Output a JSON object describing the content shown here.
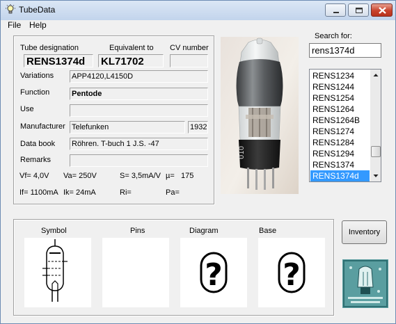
{
  "window": {
    "title": "TubeData"
  },
  "menu": {
    "file": "File",
    "help": "Help"
  },
  "labels": {
    "tube_designation": "Tube designation",
    "equivalent_to": "Equivalent to",
    "cv_number": "CV number",
    "variations": "Variations",
    "function": "Function",
    "use": "Use",
    "manufacturer": "Manufacturer",
    "data_book": "Data book",
    "remarks": "Remarks"
  },
  "tube": {
    "designation": "RENS1374d",
    "equivalent": "KL71702",
    "cv_number": "",
    "variations": "APP4120,L4150D",
    "function": "Pentode",
    "use": "",
    "manufacturer": "Telefunken",
    "year": "1932",
    "data_book": "Röhren. T-buch 1 J.S. -47",
    "remarks": ""
  },
  "specs": {
    "vf": "Vf= 4,0V",
    "va": "Va=  250V",
    "s": "S= 3,5mA/V",
    "mu": "µ=",
    "mu_value": "175",
    "if": "If= 1100mA",
    "ik": "Ik=  24mA",
    "ri": "Ri=",
    "pa": "Pa="
  },
  "search": {
    "label": "Search for:",
    "value": "rens1374d"
  },
  "tube_list": {
    "items": [
      "RENS1234",
      "RENS1244",
      "RENS1254",
      "RENS1264",
      "RENS1264B",
      "RENS1274",
      "RENS1284",
      "RENS1294",
      "RENS1374",
      "RENS1374d"
    ],
    "selected": "RENS1374d"
  },
  "panels": {
    "symbol": "Symbol",
    "pins": "Pins",
    "diagram": "Diagram",
    "base": "Base"
  },
  "buttons": {
    "inventory": "Inventory"
  },
  "icons": {
    "app": "lightbulb-icon",
    "minimize": "minimize-icon",
    "maximize": "maximize-icon",
    "close": "close-icon",
    "scroll_up": "scroll-up-arrow-icon",
    "scroll_down": "scroll-down-arrow-icon",
    "diagram_missing": "question-mark-icon",
    "base_missing": "question-mark-icon"
  },
  "colors": {
    "selection": "#3399ff",
    "close_button": "#c8432d",
    "logo_bg": "#5a9ea0"
  }
}
